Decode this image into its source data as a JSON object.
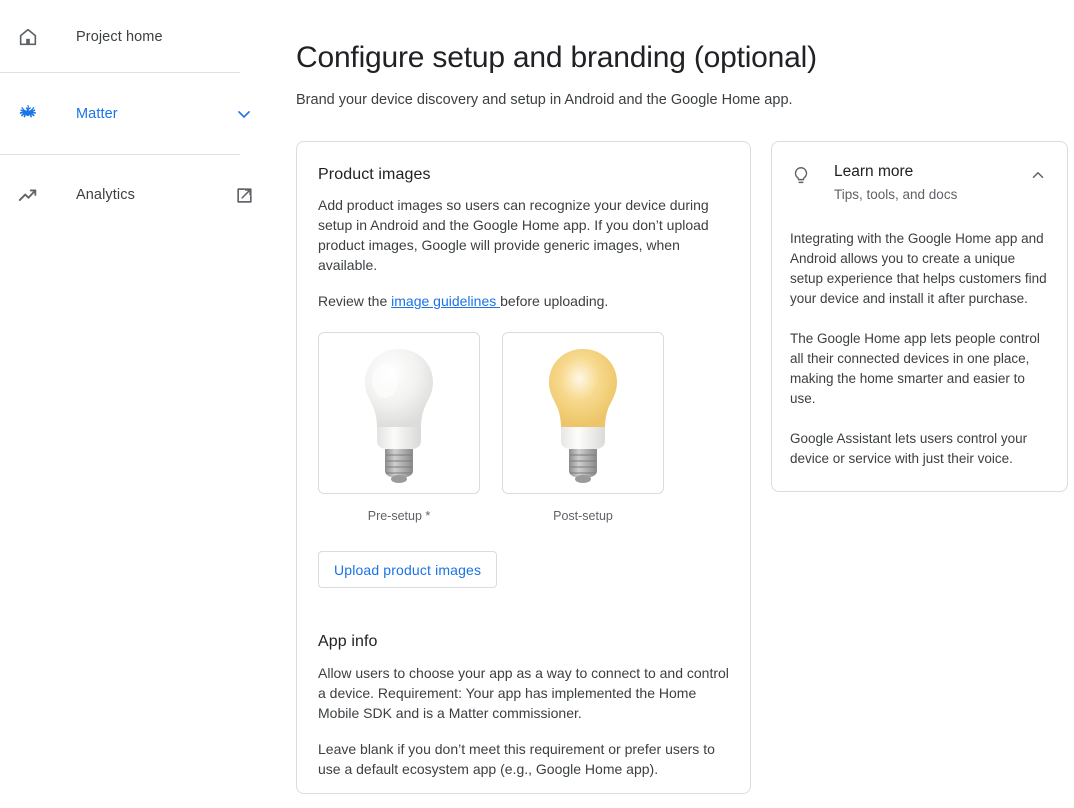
{
  "sidebar": {
    "items": [
      {
        "id": "project-home",
        "label": "Project home",
        "icon": "home-icon",
        "trailing": null,
        "active": false
      },
      {
        "id": "matter",
        "label": "Matter",
        "icon": "matter-icon",
        "trailing": "chevron-down-icon",
        "active": true
      },
      {
        "id": "analytics",
        "label": "Analytics",
        "icon": "trending-up-icon",
        "trailing": "open-in-new-icon",
        "active": false
      }
    ]
  },
  "header": {
    "title": "Configure setup and branding (optional)",
    "subtitle": "Brand your device discovery and setup in Android and the Google Home app."
  },
  "product_images": {
    "title": "Product images",
    "description": "Add product images so users can recognize your device during setup in Android and the Google Home app. If you don’t upload product images, Google will provide generic images, when available.",
    "review_prefix": "Review the ",
    "link_label": "image guidelines ",
    "review_suffix": "before uploading.",
    "thumbnails": [
      {
        "id": "pre-setup",
        "caption": "Pre-setup *",
        "alt": "white light bulb off"
      },
      {
        "id": "post-setup",
        "caption": "Post-setup",
        "alt": "light bulb glowing warm white"
      }
    ],
    "upload_button": "Upload product images"
  },
  "app_info": {
    "title": "App info",
    "paragraph_1": "Allow users to choose your app as a way to connect to and control a device. Requirement: Your app has implemented the Home Mobile SDK and is a Matter commissioner.",
    "paragraph_2": "Leave blank if you don’t meet this requirement or prefer users to use a default ecosystem app (e.g., Google Home app)."
  },
  "learn_more": {
    "title": "Learn more",
    "subtitle": "Tips, tools, and docs",
    "paragraphs": [
      "Integrating with the Google Home app and Android allows you to create a unique setup experience that helps customers find your device and install it after purchase.",
      "The Google Home app lets people control all their connected devices in one place, making the home smarter and easier to use.",
      "Google Assistant lets users control your device or service with just their voice."
    ],
    "collapse_icon": "chevron-up-icon"
  },
  "colors": {
    "accent": "#1a73e8",
    "text_primary": "#202124",
    "text_secondary": "#3c4043",
    "text_muted": "#5f6368",
    "border": "#dadce0",
    "bulb_glow": "#f5c869"
  }
}
